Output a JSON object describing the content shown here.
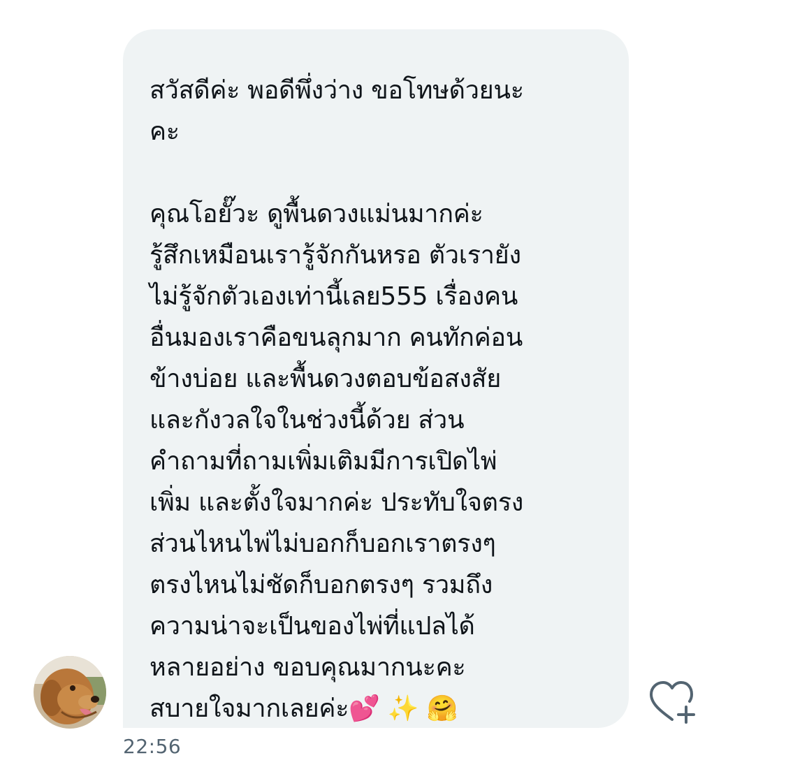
{
  "message": {
    "paragraphs": [
      [
        "สวัสดีค่ะ พอดีพึ่งว่าง ขอโทษด้วยนะ",
        "คะ"
      ],
      [
        "คุณโอยั๊วะ ดูพื้นดวงแม่นมากค่ะ",
        "รู้สึกเหมือนเรารู้จักกันหรอ ตัวเรายัง",
        "ไม่รู้จักตัวเองเท่านี้เลย555 เรื่องคน",
        "อื่นมองเราคือขนลุกมาก คนทักค่อน",
        "ข้างบ่อย และพื้นดวงตอบข้อสงสัย",
        "และกังวลใจในช่วงนี้ด้วย ส่วน",
        "คำถามที่ถามเพิ่มเติมมีการเปิดไพ่",
        "เพิ่ม และตั้งใจมากค่ะ ประทับใจตรง",
        "ส่วนไหนไพ่ไม่บอกก็บอกเราตรงๆ",
        "ตรงไหนไม่ชัดก็บอกตรงๆ รวมถึง",
        "ความน่าจะเป็นของไพ่ที่แปลได้",
        "หลายอย่าง ขอบคุณมากนะคะ",
        "สบายใจมากเลยค่ะ💕 ✨ 🤗"
      ]
    ],
    "timestamp": "22:56"
  },
  "icons": {
    "avatar": "dog-avatar",
    "react": "heart-plus-icon"
  },
  "colors": {
    "bubble_bg": "#eff3f4",
    "text": "#0f1419",
    "timestamp": "#536471",
    "icon": "#536471"
  }
}
